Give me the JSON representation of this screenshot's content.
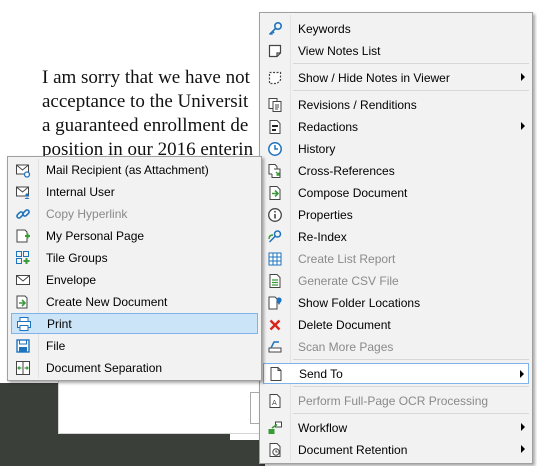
{
  "document": {
    "lines": [
      "I am sorry that we have not",
      "acceptance to the Universit",
      "a guaranteed enrollment de",
      "position in our 2016 enterin"
    ]
  },
  "main_menu": {
    "items": [
      {
        "label": "Keywords",
        "icon": "key-icon",
        "enabled": true,
        "submenu": false
      },
      {
        "label": "View Notes List",
        "icon": "notes-list-icon",
        "enabled": true,
        "submenu": false
      },
      {
        "label": "Show / Hide Notes in Viewer",
        "icon": "note-toggle-icon",
        "enabled": true,
        "submenu": true
      },
      {
        "label": "Revisions / Renditions",
        "icon": "revisions-icon",
        "enabled": true,
        "submenu": false
      },
      {
        "label": "Redactions",
        "icon": "redactions-icon",
        "enabled": true,
        "submenu": true
      },
      {
        "label": "History",
        "icon": "clock-icon",
        "enabled": true,
        "submenu": false
      },
      {
        "label": "Cross-References",
        "icon": "cross-reference-icon",
        "enabled": true,
        "submenu": false
      },
      {
        "label": "Compose Document",
        "icon": "compose-icon",
        "enabled": true,
        "submenu": false
      },
      {
        "label": "Properties",
        "icon": "info-icon",
        "enabled": true,
        "submenu": false
      },
      {
        "label": "Re-Index",
        "icon": "reindex-icon",
        "enabled": true,
        "submenu": false
      },
      {
        "label": "Create List Report",
        "icon": "list-report-icon",
        "enabled": false,
        "submenu": false
      },
      {
        "label": "Generate CSV File",
        "icon": "csv-icon",
        "enabled": false,
        "submenu": false
      },
      {
        "label": "Show Folder Locations",
        "icon": "folder-location-icon",
        "enabled": true,
        "submenu": false
      },
      {
        "label": "Delete Document",
        "icon": "delete-icon",
        "enabled": true,
        "submenu": false
      },
      {
        "label": "Scan More Pages",
        "icon": "scan-icon",
        "enabled": false,
        "submenu": false
      },
      {
        "label": "Send To",
        "icon": "send-to-icon",
        "enabled": true,
        "submenu": true
      },
      {
        "label": "Perform Full-Page OCR Processing",
        "icon": "ocr-icon",
        "enabled": false,
        "submenu": false
      },
      {
        "label": "Workflow",
        "icon": "workflow-icon",
        "enabled": true,
        "submenu": true
      },
      {
        "label": "Document Retention",
        "icon": "retention-icon",
        "enabled": true,
        "submenu": true
      }
    ]
  },
  "send_to_menu": {
    "items": [
      {
        "label": "Mail Recipient (as Attachment)",
        "icon": "mail-attachment-icon",
        "enabled": true
      },
      {
        "label": "Internal User",
        "icon": "internal-user-icon",
        "enabled": true
      },
      {
        "label": "Copy Hyperlink",
        "icon": "link-icon",
        "enabled": false
      },
      {
        "label": "My Personal Page",
        "icon": "personal-page-icon",
        "enabled": true
      },
      {
        "label": "Tile Groups",
        "icon": "tile-groups-icon",
        "enabled": true
      },
      {
        "label": "Envelope",
        "icon": "envelope-icon",
        "enabled": true
      },
      {
        "label": "Create New Document",
        "icon": "new-document-icon",
        "enabled": true
      },
      {
        "label": "Print",
        "icon": "printer-icon",
        "enabled": true
      },
      {
        "label": "File",
        "icon": "save-file-icon",
        "enabled": true
      },
      {
        "label": "Document Separation",
        "icon": "separation-icon",
        "enabled": true
      }
    ]
  },
  "state": {
    "highlighted_main": "Send To",
    "highlighted_sub": "Print"
  },
  "colors": {
    "menu_bg": "#f2f2f2",
    "highlight_bg": "#cce4f7",
    "highlight_border": "#7eb4ea",
    "disabled_text": "#8a8a8a",
    "icon_blue": "#1e73be",
    "icon_green": "#3a9a3a",
    "delete_red": "#d9241c"
  }
}
